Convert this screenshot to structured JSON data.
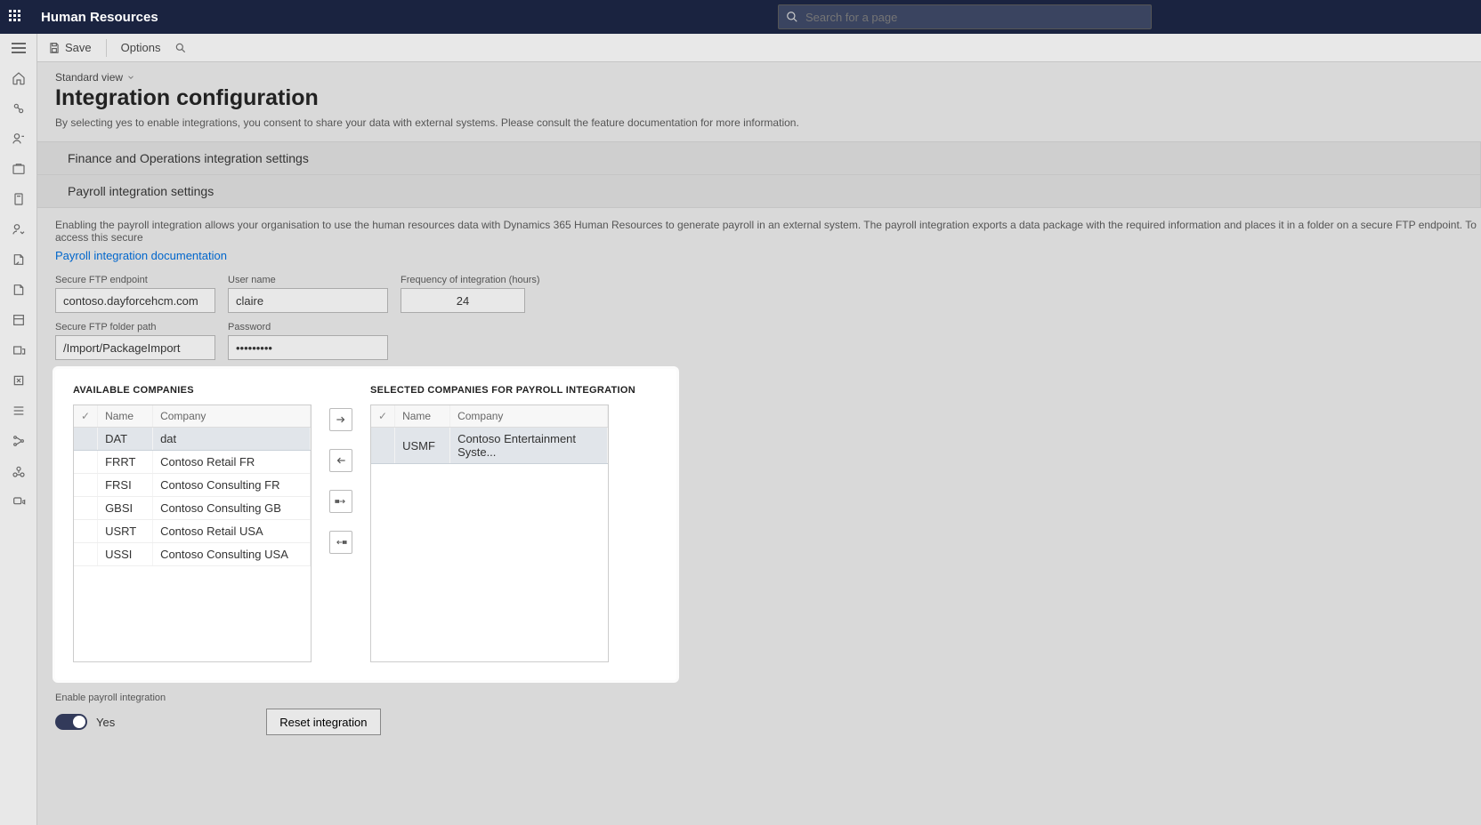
{
  "header": {
    "app_title": "Human Resources",
    "search_placeholder": "Search for a page"
  },
  "cmdbar": {
    "save": "Save",
    "options": "Options"
  },
  "page": {
    "view_label": "Standard view",
    "title": "Integration configuration",
    "description": "By selecting yes to enable integrations, you consent to share your data with external systems. Please consult the feature documentation for more information."
  },
  "sections": {
    "finops": "Finance and Operations integration settings",
    "payroll": "Payroll integration settings"
  },
  "payroll": {
    "help": "Enabling the payroll integration allows your organisation to use the human resources data with Dynamics 365 Human Resources to generate payroll in an external system. The payroll integration exports a data package with the required information and places it in a folder on a secure FTP endpoint. To access this secure",
    "doc_link": "Payroll integration documentation",
    "fields": {
      "endpoint_label": "Secure FTP endpoint",
      "endpoint_value": "contoso.dayforcehcm.com",
      "user_label": "User name",
      "user_value": "claire",
      "freq_label": "Frequency of integration (hours)",
      "freq_value": "24",
      "folder_label": "Secure FTP folder path",
      "folder_value": "/Import/PackageImport",
      "pass_label": "Password",
      "pass_value": "•••••••••"
    },
    "available_title": "AVAILABLE COMPANIES",
    "selected_title": "SELECTED COMPANIES FOR PAYROLL INTEGRATION",
    "col_name": "Name",
    "col_company": "Company",
    "available": [
      {
        "name": "DAT",
        "company": "dat",
        "selected": true
      },
      {
        "name": "FRRT",
        "company": "Contoso Retail FR"
      },
      {
        "name": "FRSI",
        "company": "Contoso Consulting FR"
      },
      {
        "name": "GBSI",
        "company": "Contoso Consulting GB"
      },
      {
        "name": "USRT",
        "company": "Contoso Retail USA"
      },
      {
        "name": "USSI",
        "company": "Contoso Consulting USA"
      }
    ],
    "selected": [
      {
        "name": "USMF",
        "company": "Contoso Entertainment Syste...",
        "selected": true
      }
    ],
    "enable_label": "Enable payroll integration",
    "enable_value": "Yes",
    "reset_label": "Reset integration"
  }
}
